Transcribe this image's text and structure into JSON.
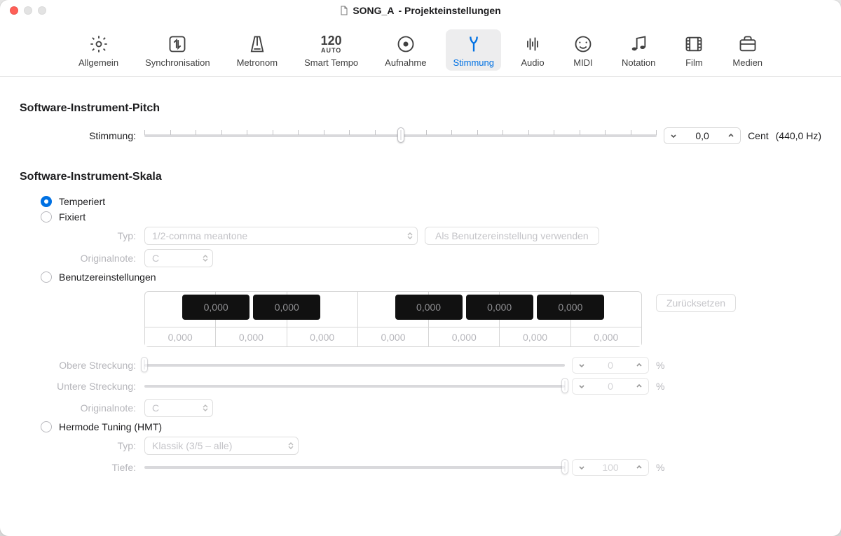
{
  "window": {
    "title_doc": "SONG_A",
    "title_suffix": "- Projekteinstellungen"
  },
  "tabs": {
    "allgemein": "Allgemein",
    "synchronisation": "Synchronisation",
    "metronom": "Metronom",
    "smarttempo_value": "120",
    "smarttempo_mode": "AUTO",
    "smarttempo": "Smart Tempo",
    "aufnahme": "Aufnahme",
    "stimmung": "Stimmung",
    "audio": "Audio",
    "midi": "MIDI",
    "notation": "Notation",
    "film": "Film",
    "medien": "Medien"
  },
  "pitch": {
    "section": "Software-Instrument-Pitch",
    "label": "Stimmung:",
    "value": "0,0",
    "unit": "Cent",
    "freq": "(440,0 Hz)"
  },
  "scale": {
    "section": "Software-Instrument-Skala",
    "temperiert": "Temperiert",
    "fixiert": "Fixiert",
    "typ_label": "Typ:",
    "typ_value": "1/2-comma meantone",
    "use_as_user": "Als Benutzereinstellung verwenden",
    "origin_label": "Originalnote:",
    "origin_value": "C",
    "user": "Benutzereinstellungen",
    "reset": "Zurücksetzen",
    "black": [
      "0,000",
      "0,000",
      "0,000",
      "0,000",
      "0,000"
    ],
    "white": [
      "0,000",
      "0,000",
      "0,000",
      "0,000",
      "0,000",
      "0,000",
      "0,000"
    ],
    "upper_label": "Obere Streckung:",
    "upper_value": "0",
    "lower_label": "Untere Streckung:",
    "lower_value": "0",
    "percent": "%",
    "origin2_label": "Originalnote:",
    "origin2_value": "C",
    "hmt": "Hermode Tuning (HMT)",
    "hmt_typ_label": "Typ:",
    "hmt_typ_value": "Klassik (3/5 – alle)",
    "depth_label": "Tiefe:",
    "depth_value": "100"
  }
}
